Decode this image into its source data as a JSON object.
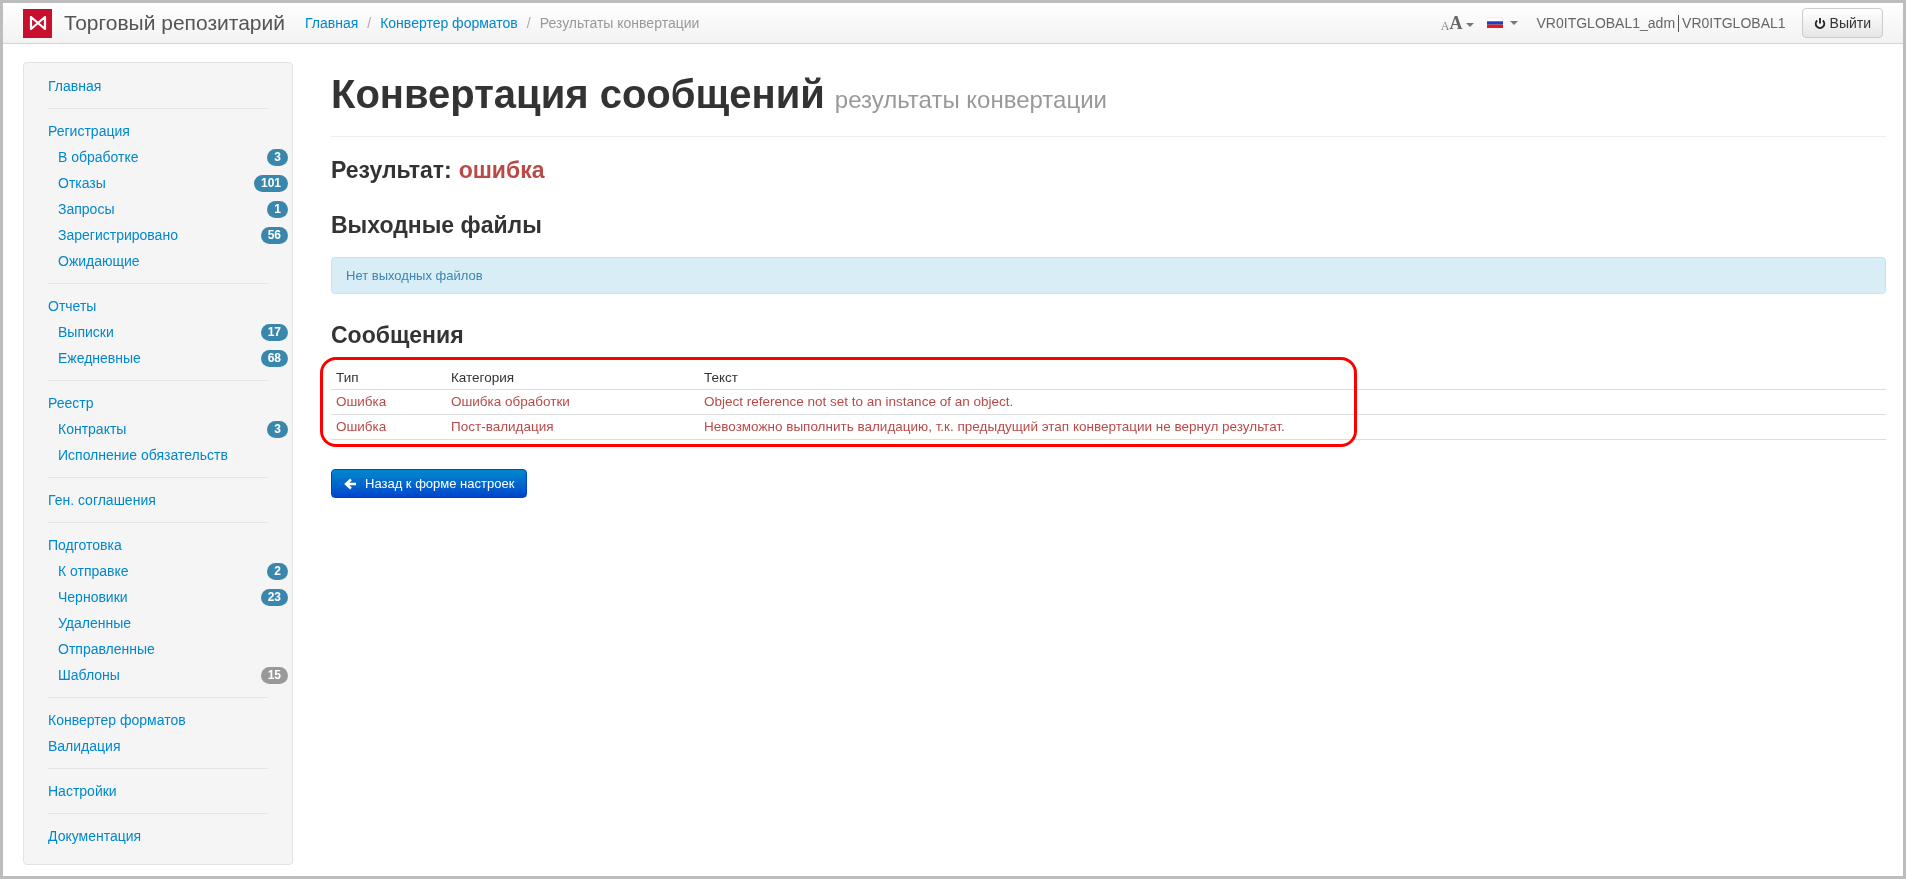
{
  "header": {
    "app_title": "Торговый репозитарий",
    "font_size_glyphs": [
      "A",
      "A"
    ],
    "breadcrumb_separator": "/",
    "breadcrumbs": [
      {
        "label": "Главная",
        "link": true
      },
      {
        "label": "Конвертер форматов",
        "link": true
      },
      {
        "label": "Результаты конвертации",
        "link": false
      }
    ],
    "user": "VR0ITGLOBAL1_adm",
    "organization": "VR0ITGLOBAL1",
    "logout": "Выйти"
  },
  "sidebar": {
    "groups": [
      [
        {
          "label": "Главная"
        }
      ],
      [
        {
          "label": "Регистрация",
          "children": [
            {
              "label": "В обработке",
              "badge": "3",
              "color": "#3a87ad"
            },
            {
              "label": "Отказы",
              "badge": "101",
              "color": "#3a87ad"
            },
            {
              "label": "Запросы",
              "badge": "1",
              "color": "#3a87ad"
            },
            {
              "label": "Зарегистрировано",
              "badge": "56",
              "color": "#3a87ad"
            },
            {
              "label": "Ожидающие"
            }
          ]
        }
      ],
      [
        {
          "label": "Отчеты",
          "children": [
            {
              "label": "Выписки",
              "badge": "17",
              "color": "#3a87ad"
            },
            {
              "label": "Ежедневные",
              "badge": "68",
              "color": "#3a87ad"
            }
          ]
        }
      ],
      [
        {
          "label": "Реестр",
          "children": [
            {
              "label": "Контракты",
              "badge": "3",
              "color": "#3a87ad"
            },
            {
              "label": "Исполнение обязательств"
            }
          ]
        }
      ],
      [
        {
          "label": "Ген. соглашения"
        }
      ],
      [
        {
          "label": "Подготовка",
          "children": [
            {
              "label": "К отправке",
              "badge": "2",
              "color": "#3a87ad"
            },
            {
              "label": "Черновики",
              "badge": "23",
              "color": "#3a87ad"
            },
            {
              "label": "Удаленные"
            },
            {
              "label": "Отправленные"
            },
            {
              "label": "Шаблоны",
              "badge": "15",
              "color": "#999999"
            }
          ]
        }
      ],
      [
        {
          "label": "Конвертер форматов"
        },
        {
          "label": "Валидация"
        }
      ],
      [
        {
          "label": "Настройки"
        }
      ],
      [
        {
          "label": "Документация"
        }
      ]
    ]
  },
  "page": {
    "title": "Конвертация сообщений",
    "subtitle": "результаты конвертации",
    "result_label": "Результат:",
    "result_value": "ошибка",
    "output_heading": "Выходные файлы",
    "output_empty": "Нет выходных файлов",
    "messages_heading": "Сообщения",
    "table": {
      "columns": [
        "Тип",
        "Категория",
        "Текст"
      ],
      "rows": [
        [
          "Ошибка",
          "Ошибка обработки",
          "Object reference not set to an instance of an object."
        ],
        [
          "Ошибка",
          "Пост-валидация",
          "Невозможно выполнить валидацию, т.к. предыдущий этап конвертации не вернул результат."
        ]
      ]
    },
    "back_button": "Назад к форме настроек"
  }
}
